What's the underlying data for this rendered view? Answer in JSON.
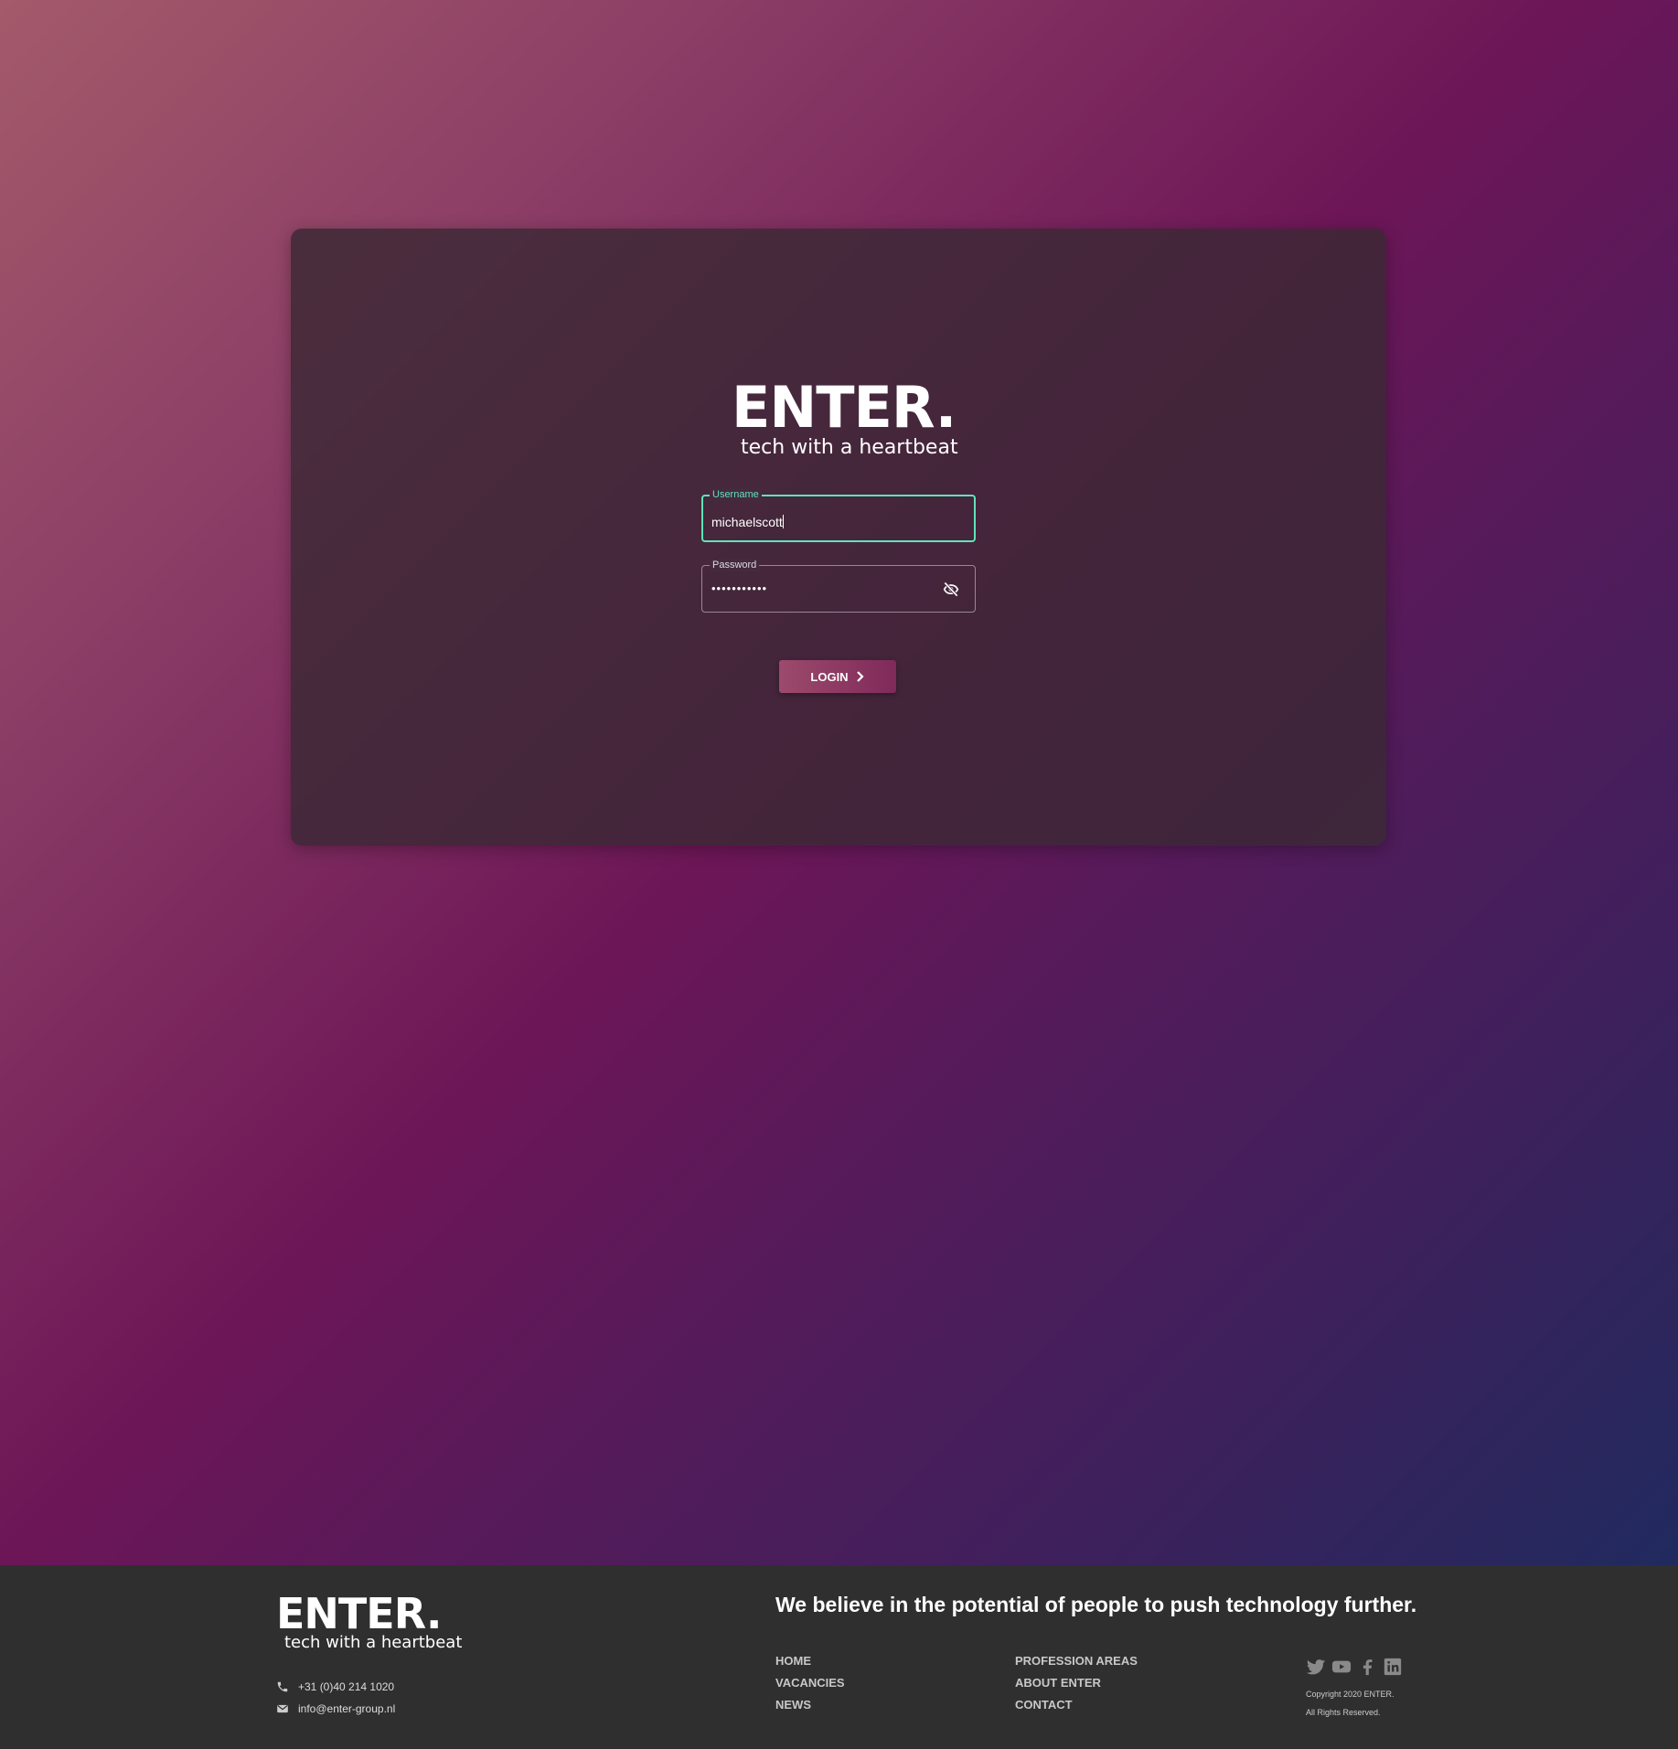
{
  "brand": {
    "name": "ENTER.",
    "tagline": "tech with a heartbeat"
  },
  "login": {
    "username_label": "Username",
    "username_value": "michaelscott",
    "password_label": "Password",
    "password_value": "•••••••••••",
    "button_label": "LOGIN",
    "accent_color": "#5fe3ba"
  },
  "footer": {
    "phone": "+31 (0)40 214 1020",
    "email": "info@enter-group.nl",
    "slogan": "We believe in the potential of people to push technology further.",
    "nav_col1": [
      "HOME",
      "VACANCIES",
      "NEWS"
    ],
    "nav_col2": [
      "PROFESSION AREAS",
      "ABOUT ENTER",
      "CONTACT"
    ],
    "social_icons": [
      "twitter-icon",
      "youtube-icon",
      "facebook-icon",
      "linkedin-icon"
    ],
    "copyright": "Copyright 2020 ENTER.",
    "rights": "All Rights Reserved."
  }
}
